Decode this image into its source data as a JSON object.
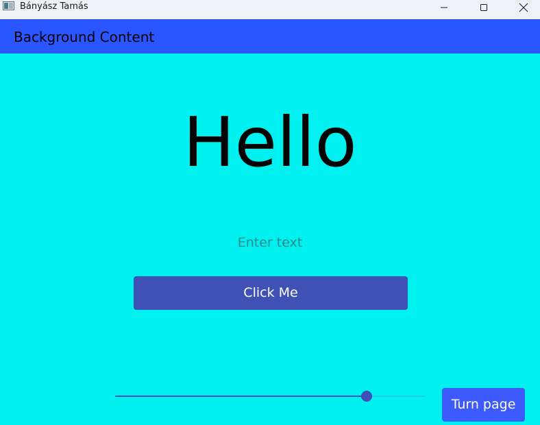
{
  "window": {
    "title": "Bányász Tamás",
    "icons": {
      "app": "app-window-icon",
      "minimize": "minimize-icon",
      "maximize": "maximize-icon",
      "close": "close-icon"
    }
  },
  "header": {
    "title": "Background Content"
  },
  "main": {
    "heading": "Hello",
    "input": {
      "value": "",
      "placeholder": "Enter text"
    },
    "click_button_label": "Click Me"
  },
  "footer": {
    "slider": {
      "value": 0.81,
      "min": 0,
      "max": 1
    },
    "turn_page_label": "Turn page"
  },
  "colors": {
    "background": "#00f0f0",
    "header_bar": "#2a56ff",
    "button_primary": "#3f51b5",
    "button_accent": "#3d5afe",
    "slider_track": "#22cfe0"
  }
}
